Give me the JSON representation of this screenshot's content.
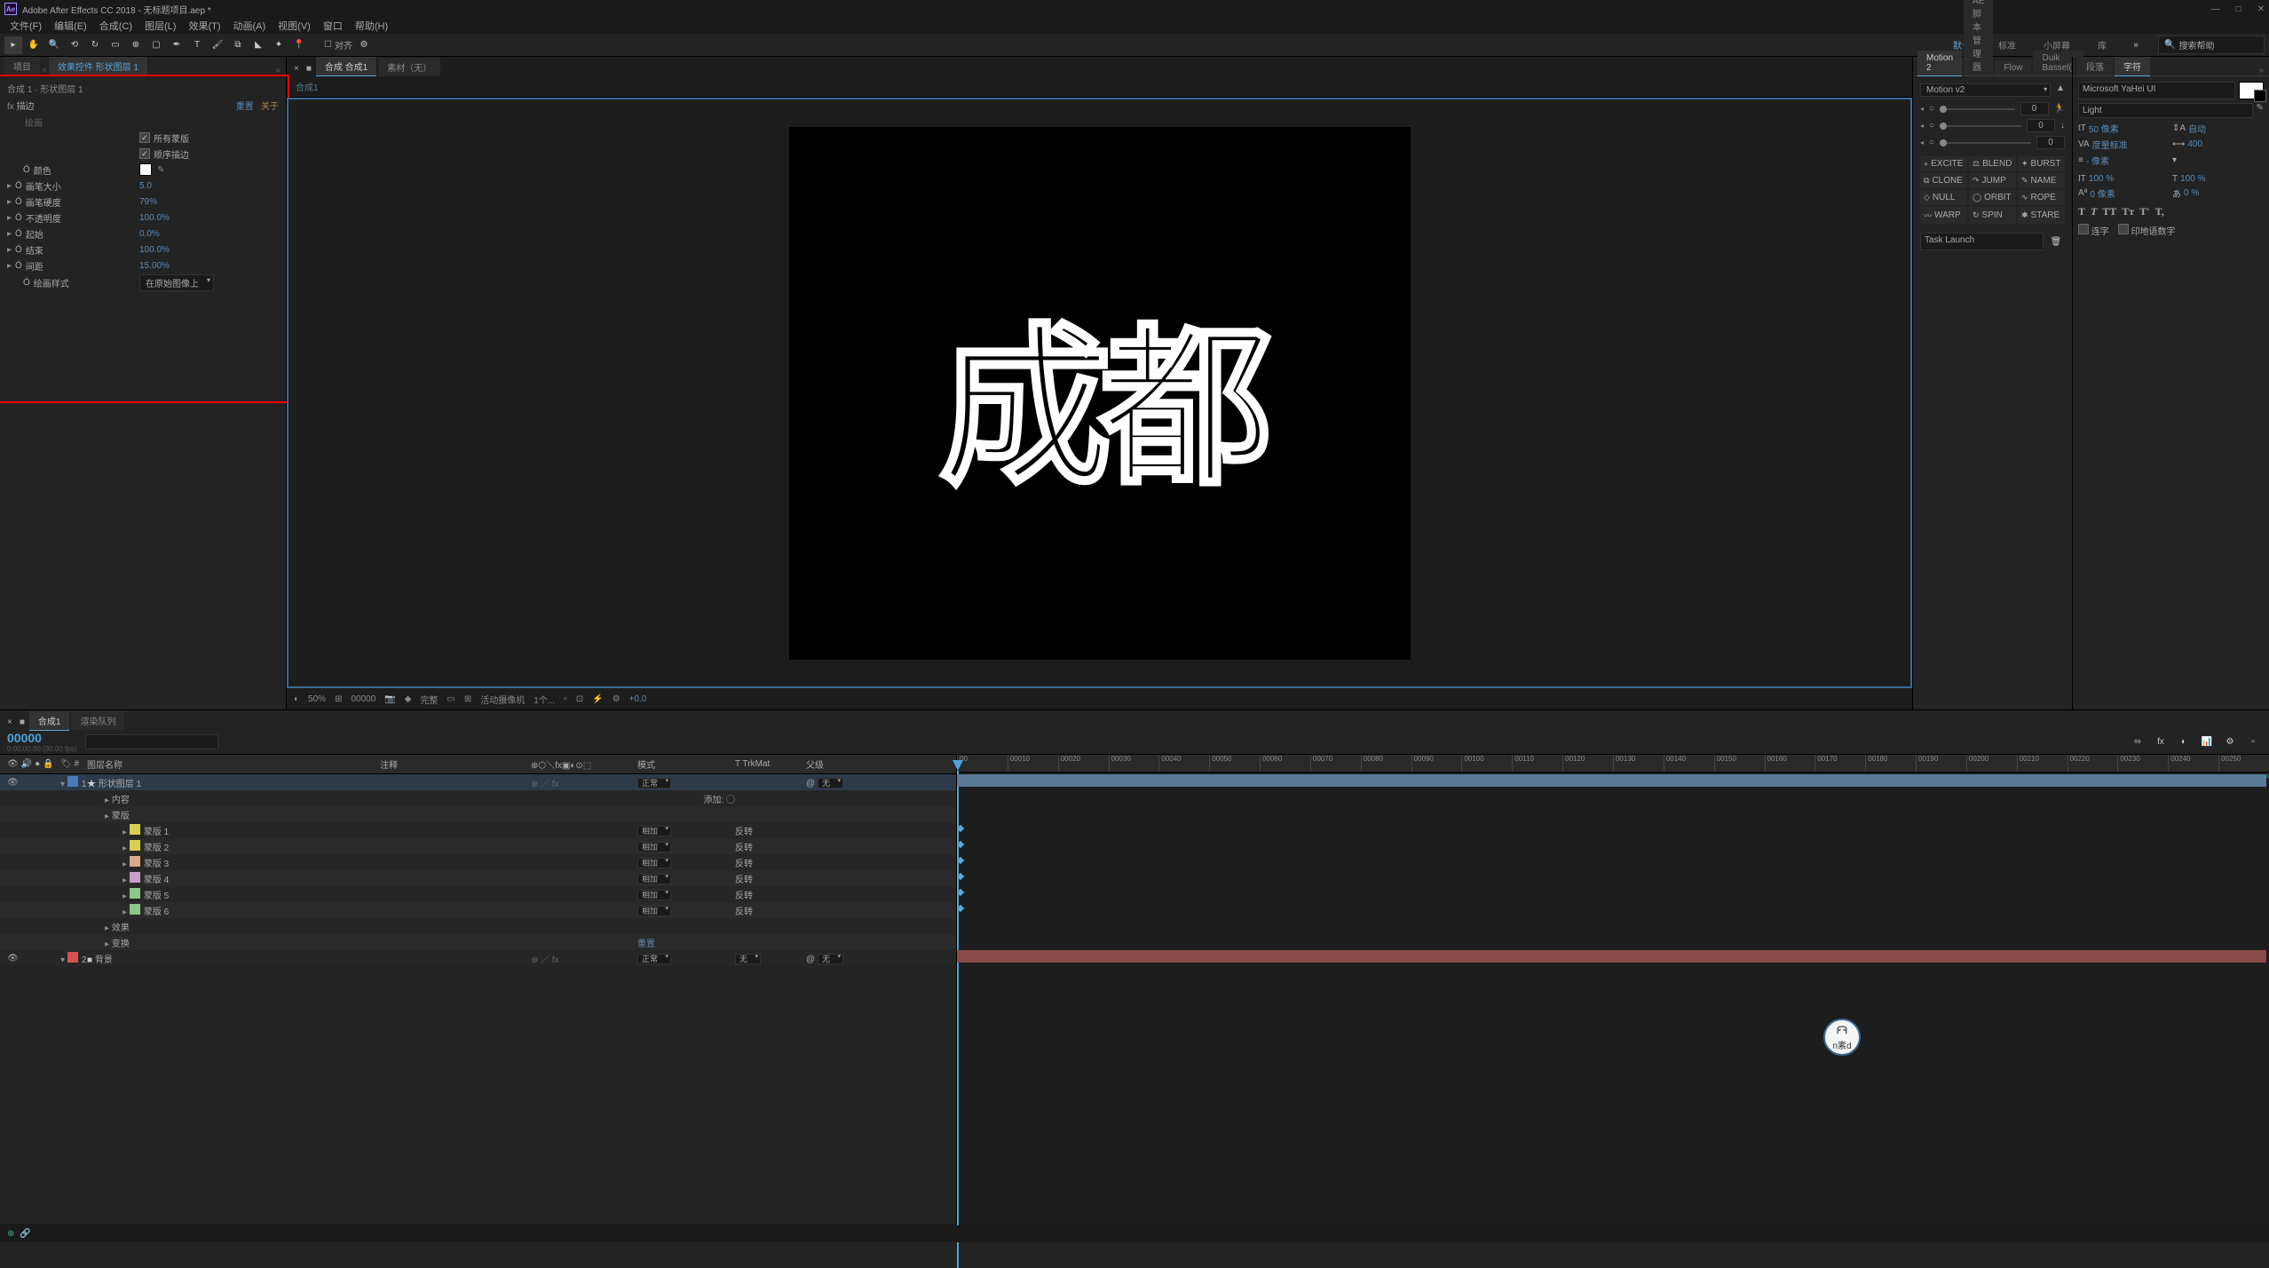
{
  "titlebar": {
    "app_icon": "Ae",
    "title": "Adobe After Effects CC 2018 - 无标题项目.aep *"
  },
  "menubar": {
    "items": [
      "文件(F)",
      "编辑(E)",
      "合成(C)",
      "图层(L)",
      "效果(T)",
      "动画(A)",
      "视图(V)",
      "窗口",
      "帮助(H)"
    ]
  },
  "toolbar": {
    "snap_label": "对齐",
    "workspaces": [
      "默认",
      "标准",
      "小屏幕",
      "库"
    ],
    "search_placeholder": "搜索帮助"
  },
  "left_panel": {
    "tabs": [
      "项目",
      "效果控件 形状图层 1"
    ],
    "active_tab": 1,
    "layer_path": "合成 1 · 形状图层 1",
    "effect_name": "描边",
    "reset": "重置",
    "about": "关于",
    "paint_label": "绘画",
    "cb_all_masks": "所有蒙版",
    "cb_stroke_seq": "顺序描边",
    "props": [
      {
        "label": "颜色",
        "value": "",
        "type": "color"
      },
      {
        "label": "画笔大小",
        "value": "5.0"
      },
      {
        "label": "画笔硬度",
        "value": "79%"
      },
      {
        "label": "不透明度",
        "value": "100.0%"
      },
      {
        "label": "起始",
        "value": "0.0%"
      },
      {
        "label": "结束",
        "value": "100.0%"
      },
      {
        "label": "间距",
        "value": "15.00%"
      }
    ],
    "style_label": "绘画样式",
    "style_value": "在原始图像上"
  },
  "comp_panel": {
    "tabs": [
      "合成 合成1",
      "素材（无）"
    ],
    "breadcrumb": "合成1",
    "canvas_text": "成都",
    "controls": {
      "zoom": "50%",
      "time": "00000",
      "res": "完整",
      "camera": "活动摄像机",
      "views": "1个...",
      "exposure": "+0.0"
    }
  },
  "motion_panel": {
    "tabs": [
      "Motion 2",
      "AE脚本管理器",
      "Flow",
      "Duik Bassel()"
    ],
    "dropdown": "Motion v2",
    "sliders": [
      {
        "val": "0"
      },
      {
        "val": "0"
      },
      {
        "val": "0"
      }
    ],
    "buttons": [
      [
        "+",
        "EXCITE"
      ],
      [
        "⚖",
        "BLEND"
      ],
      [
        "✦",
        "BURST"
      ],
      [
        "⧉",
        "CLONE"
      ],
      [
        "↷",
        "JUMP"
      ],
      [
        "✎",
        "NAME"
      ],
      [
        "◇",
        "NULL"
      ],
      [
        "◯",
        "ORBIT"
      ],
      [
        "∿",
        "ROPE"
      ],
      [
        "〰",
        "WARP"
      ],
      [
        "↻",
        "SPIN"
      ],
      [
        "✱",
        "STARE"
      ]
    ],
    "task_label": "Task Launch"
  },
  "char_panel": {
    "tabs": [
      "段落",
      "字符"
    ],
    "font": "Microsoft YaHei UI",
    "style": "Light",
    "size": "50 像素",
    "leading": "自动",
    "kerning": "度量标准",
    "tracking": "400",
    "stroke": "- 像素",
    "vscale": "100 %",
    "hscale": "100 %",
    "baseline": "0 像素",
    "tsume": "0 %",
    "styles": [
      "T",
      "T",
      "TT",
      "Tт",
      "T'",
      "T,"
    ],
    "cb_ligatures": "连字",
    "cb_hindi": "印地语数字"
  },
  "timeline": {
    "tabs": [
      "合成1",
      "渲染队列"
    ],
    "timecode": "00000",
    "timecode_sub": "0:00:00.00 (30.00 fps)",
    "search_ph": "",
    "columns": {
      "name": "图层名称",
      "comment": "注释",
      "mode": "模式",
      "trkmat": "T TrkMat",
      "parent": "父级"
    },
    "layers": [
      {
        "idx": "1",
        "color": "#4a7aba",
        "icon": "★",
        "name": "形状图层 1",
        "mode": "正常",
        "parent": "无"
      },
      {
        "indent": 1,
        "name": "内容",
        "add_label": "添加:"
      },
      {
        "indent": 1,
        "name": "蒙版"
      },
      {
        "indent": 2,
        "color": "#d8d050",
        "name": "蒙版 1",
        "mode": "相加",
        "inv": "反转"
      },
      {
        "indent": 2,
        "color": "#d8d050",
        "name": "蒙版 2",
        "mode": "相加",
        "inv": "反转"
      },
      {
        "indent": 2,
        "color": "#d8a888",
        "name": "蒙版 3",
        "mode": "相加",
        "inv": "反转"
      },
      {
        "indent": 2,
        "color": "#c8a0c8",
        "name": "蒙版 4",
        "mode": "相加",
        "inv": "反转"
      },
      {
        "indent": 2,
        "color": "#88c888",
        "name": "蒙版 5",
        "mode": "相加",
        "inv": "反转"
      },
      {
        "indent": 2,
        "color": "#88c888",
        "name": "蒙版 6",
        "mode": "相加",
        "inv": "反转"
      },
      {
        "indent": 1,
        "name": "效果"
      },
      {
        "indent": 1,
        "name": "变换",
        "reset": "重置"
      },
      {
        "idx": "2",
        "color": "#d85050",
        "icon": "■",
        "name": "背景",
        "mode": "正常",
        "trkmat": "无",
        "parent": "无"
      }
    ],
    "ruler_marks": [
      "00",
      "00010",
      "00020",
      "00030",
      "00040",
      "00050",
      "00060",
      "00070",
      "00080",
      "00090",
      "00100",
      "00110",
      "00120",
      "00130",
      "00140",
      "00150",
      "00160",
      "00170",
      "00180",
      "00190",
      "00200",
      "00210",
      "00220",
      "00230",
      "00240",
      "00250"
    ]
  }
}
